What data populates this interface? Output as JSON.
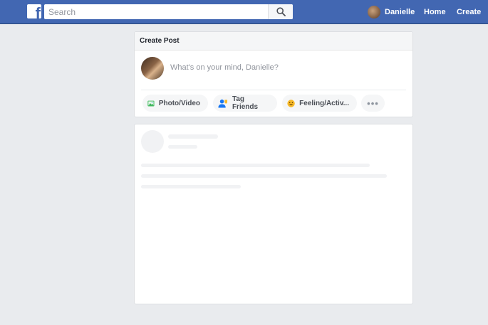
{
  "topbar": {
    "logo": "f",
    "search_placeholder": "Search",
    "user_name": "Danielle",
    "home_label": "Home",
    "create_label": "Create",
    "bg_color": "#4267b2"
  },
  "composer": {
    "title": "Create Post",
    "placeholder": "What's on your mind, Danielle?",
    "actions": [
      {
        "label": "Photo/Video",
        "icon": "photo-icon"
      },
      {
        "label": "Tag Friends",
        "icon": "tag-friends-icon"
      },
      {
        "label": "Feeling/Activ...",
        "icon": "feeling-icon"
      },
      {
        "label": "•••",
        "icon": "more-icon"
      }
    ]
  },
  "colors": {
    "page_bg": "#e9ebee",
    "accent": "#4267b2",
    "placeholder_gray": "#f1f2f4"
  }
}
